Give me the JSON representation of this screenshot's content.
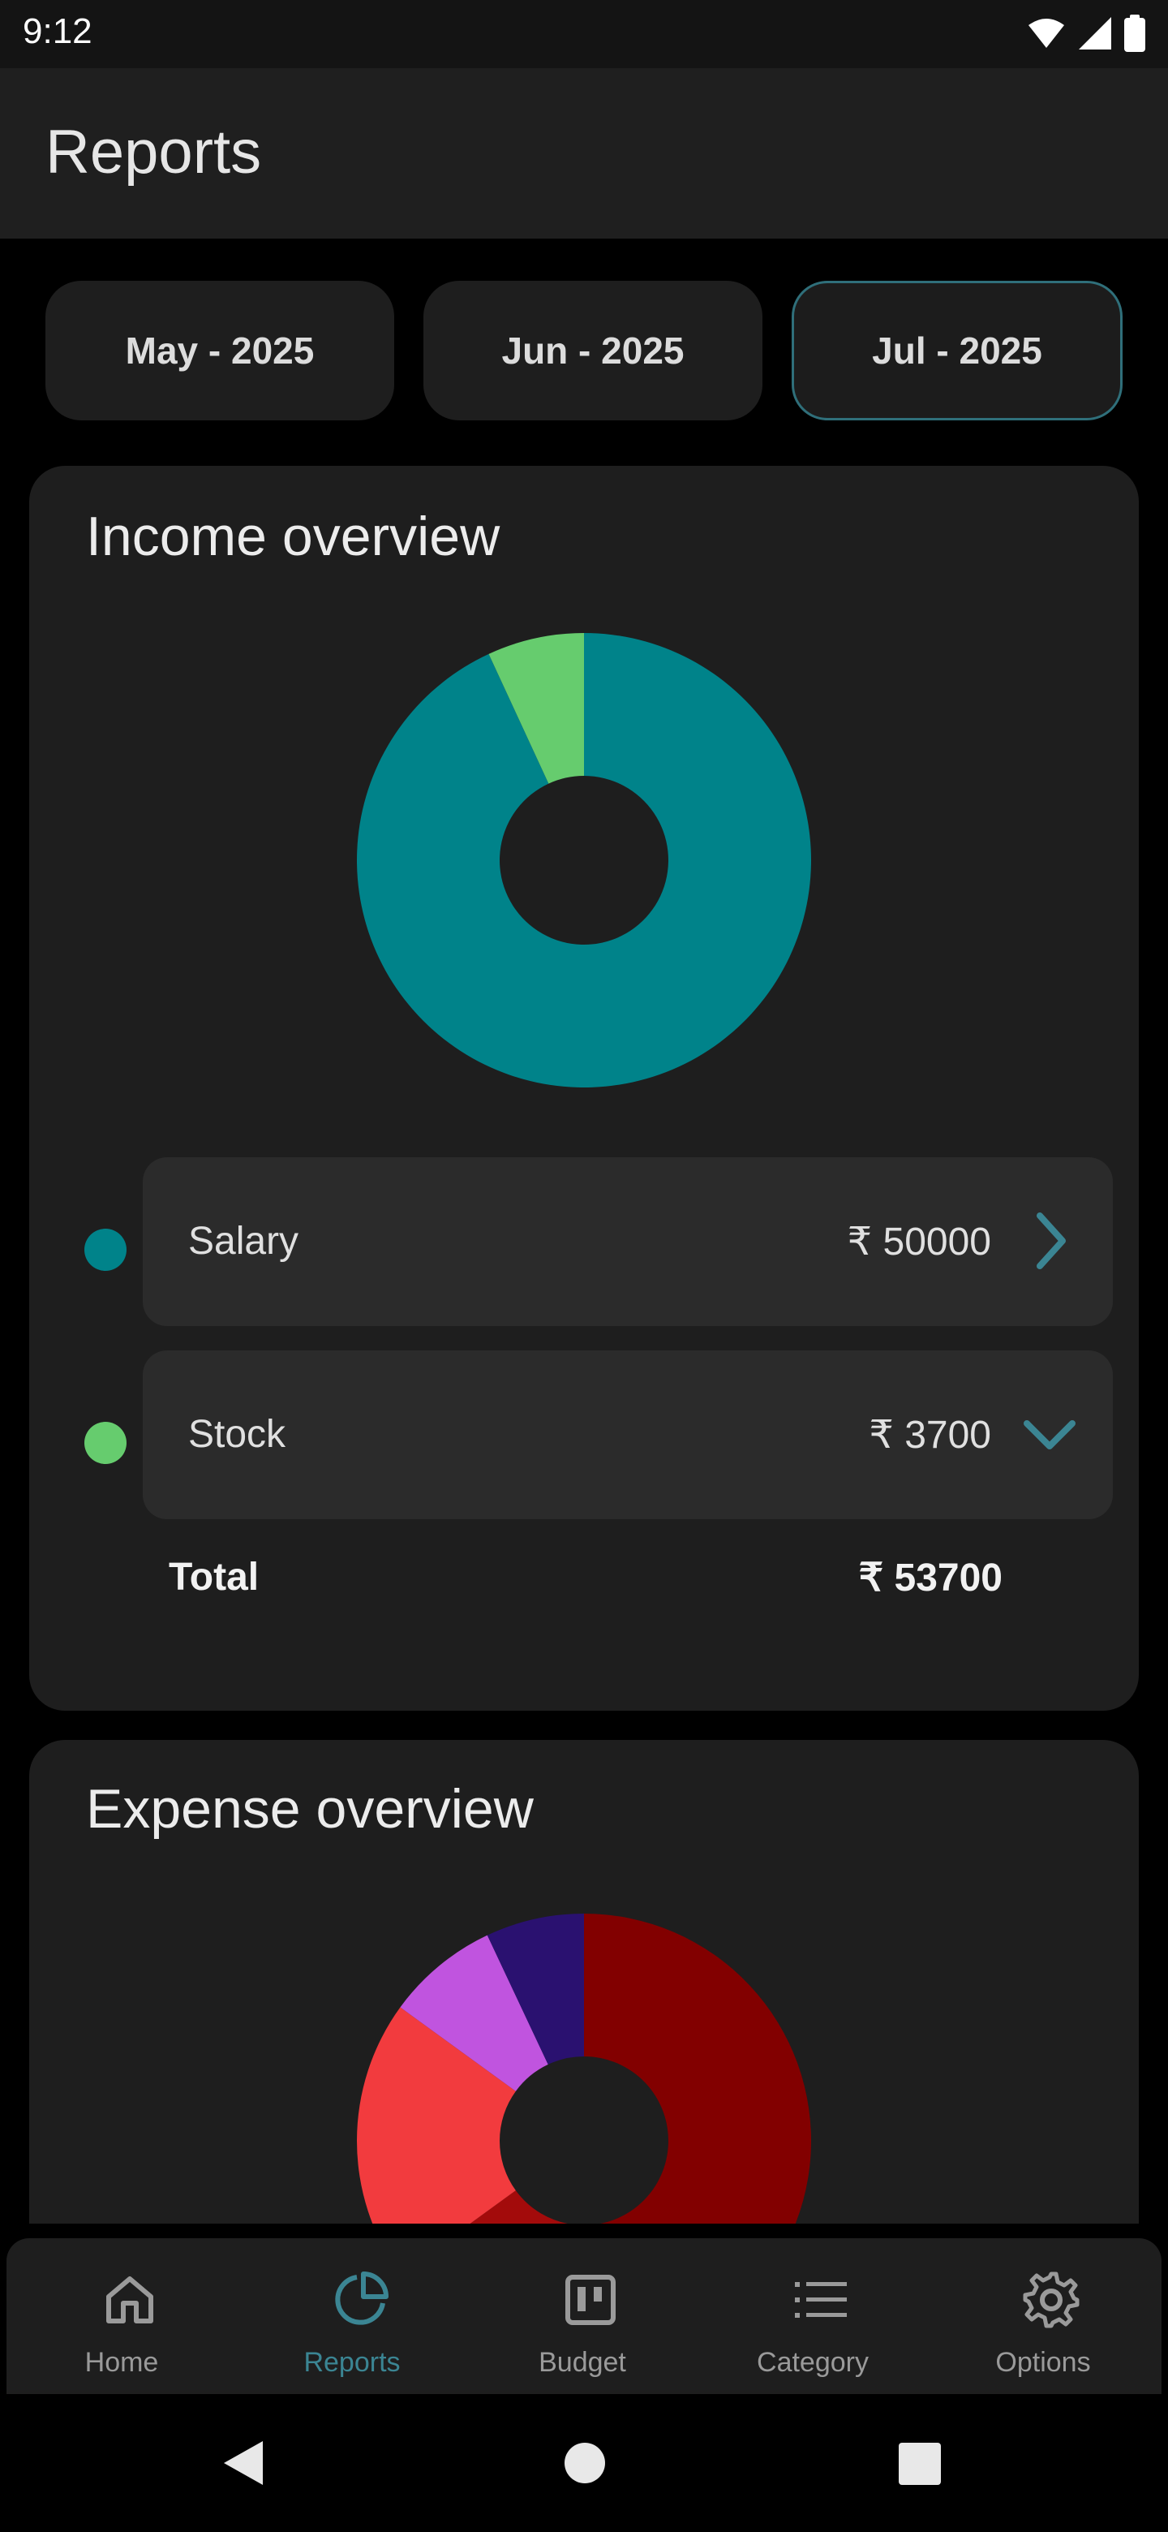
{
  "status_bar": {
    "time": "9:12"
  },
  "app_bar": {
    "title": "Reports"
  },
  "months": [
    {
      "label": "May - 2025",
      "selected": false
    },
    {
      "label": "Jun - 2025",
      "selected": false
    },
    {
      "label": "Jul - 2025",
      "selected": true
    }
  ],
  "income": {
    "title": "Income overview",
    "items": [
      {
        "label": "Salary",
        "amount": "₹ 50000",
        "value": 50000,
        "color": "#00838a",
        "expand_icon": "chevron-right-icon"
      },
      {
        "label": "Stock",
        "amount": "₹ 3700",
        "value": 3700,
        "color": "#66cc6e",
        "expand_icon": "chevron-down-icon"
      }
    ],
    "total_label": "Total",
    "total_value": "₹ 53700"
  },
  "expense": {
    "title": "Expense overview",
    "slice_colors": [
      "#820000",
      "#a30b0b",
      "#f23b3e",
      "#c054df",
      "#2a1170"
    ]
  },
  "chart_data": [
    {
      "type": "pie",
      "title": "Income overview",
      "categories": [
        "Salary",
        "Stock"
      ],
      "values": [
        50000,
        3700
      ],
      "colors": [
        "#00838a",
        "#66cc6e"
      ],
      "donut": true
    },
    {
      "type": "pie",
      "title": "Expense overview",
      "categories": [
        "",
        "",
        "",
        "",
        ""
      ],
      "values": [
        52,
        13,
        20,
        8,
        7
      ],
      "colors": [
        "#820000",
        "#a30b0b",
        "#f23b3e",
        "#c054df",
        "#2a1170"
      ],
      "donut": true
    }
  ],
  "bottom_nav": [
    {
      "label": "Home",
      "icon": "home-icon",
      "active": false
    },
    {
      "label": "Reports",
      "icon": "pie-chart-icon",
      "active": true
    },
    {
      "label": "Budget",
      "icon": "budget-board-icon",
      "active": false
    },
    {
      "label": "Category",
      "icon": "list-icon",
      "active": false
    },
    {
      "label": "Options",
      "icon": "gear-icon",
      "active": false
    }
  ],
  "colors": {
    "accent": "#3b8593",
    "card": "#1e1e1e",
    "row": "#2b2b2b"
  }
}
